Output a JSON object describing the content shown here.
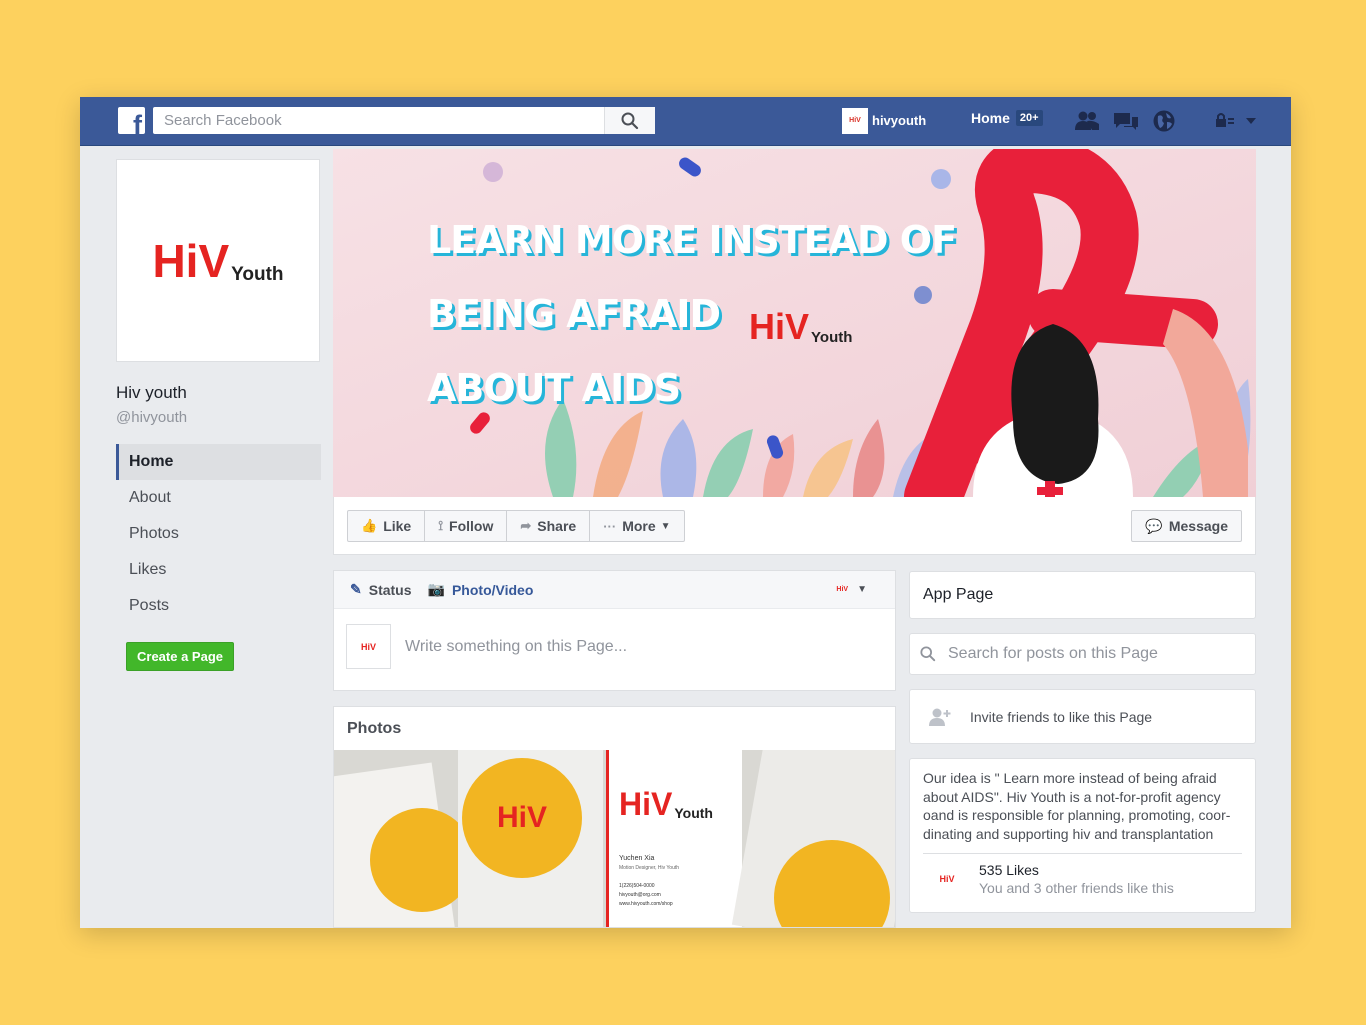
{
  "topbar": {
    "logo_letter": "f",
    "search_placeholder": "Search Facebook",
    "profile_name": "hivyouth",
    "profile_avatar_text": "HiV",
    "home_label": "Home",
    "home_badge": "20+"
  },
  "page": {
    "logo_main": "HiV",
    "logo_sub": "Youth",
    "name": "Hiv youth",
    "handle": "@hivyouth"
  },
  "side_nav": {
    "items": [
      {
        "label": "Home"
      },
      {
        "label": "About"
      },
      {
        "label": "Photos"
      },
      {
        "label": "Likes"
      },
      {
        "label": "Posts"
      }
    ],
    "create_page": "Create a Page"
  },
  "cover": {
    "headline_lines": [
      "LEARN MORE INSTEAD OF",
      "BEING AFRAID",
      "ABOUT AIDS"
    ],
    "logo_main": "HiV",
    "logo_sub": "Youth"
  },
  "actions": {
    "like": "Like",
    "follow": "Follow",
    "share": "Share",
    "more": "More",
    "message": "Message"
  },
  "composer": {
    "tab_status": "Status",
    "tab_photo": "Photo/Video",
    "avatar_text": "HiV",
    "placeholder": "Write something on this Page..."
  },
  "photos": {
    "title": "Photos",
    "card_name": "Yuchen Xia",
    "card_role": "Motion Designer, Hiv Youth",
    "card_phone": "1(226)504-0000",
    "card_email": "hivyouth@org.com",
    "card_web": "www.hivyouth.com/shop"
  },
  "right": {
    "app_page": "App Page",
    "search_placeholder": "Search for posts on this Page",
    "invite": "Invite friends to like this Page",
    "about_text": "Our idea is \" Learn more instead of being afraid about AIDS\". Hiv Youth is a not-for-profit agency oand is responsible for planning, promoting, coor-dinating and supporting hiv and transplantation",
    "likes_count": "535 Likes",
    "likes_sub": "You and 3 other friends like this",
    "likes_avatar_text": "HiV"
  },
  "colors": {
    "fb_blue": "#3b5998",
    "background": "#fdd15e",
    "brand_red": "#e52421",
    "create_green": "#42b72a"
  }
}
